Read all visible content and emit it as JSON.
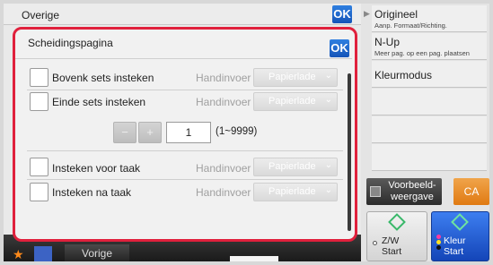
{
  "background_window": {
    "title": "Overige",
    "ok_label": "OK"
  },
  "bottom_bar": {
    "back_label": "Vorige"
  },
  "right_panel": {
    "items": [
      {
        "main": "Origineel",
        "sub": "Aanp. Formaat/Richting."
      },
      {
        "main": "N-Up",
        "sub": "Meer pag. op een pag. plaatsen"
      },
      {
        "main": "Kleurmodus",
        "sub": ""
      }
    ],
    "preview_label": "Voorbeeld-weergave",
    "ca_label": "CA",
    "start_bw": {
      "line1": "Z/W",
      "line2": "Start"
    },
    "start_color": {
      "line1": "Kleur",
      "line2": "Start"
    }
  },
  "dialog": {
    "title": "Scheidingspagina",
    "ok_label": "OK",
    "rows": [
      {
        "label": "Bovenk sets insteken",
        "mode": "Handinvoer",
        "tray": "Papierlade"
      },
      {
        "label": "Einde sets insteken",
        "mode": "Handinvoer",
        "tray": "Papierlade"
      },
      {
        "label": "Insteken voor taak",
        "mode": "Handinvoer",
        "tray": "Papierlade"
      },
      {
        "label": "Insteken na taak",
        "mode": "Handinvoer",
        "tray": "Papierlade"
      }
    ],
    "stepper": {
      "minus": "−",
      "plus": "+",
      "value": "1",
      "range": "(1~9999)"
    }
  },
  "colors": {
    "accent_border": "#e0203c",
    "ok_blue": "#1f66d0",
    "ca_orange": "#e88a22"
  }
}
